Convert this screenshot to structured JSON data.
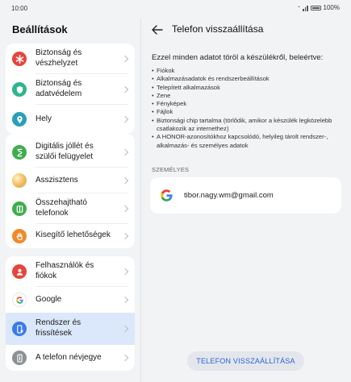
{
  "status_bar": {
    "time": "10:00",
    "battery": "100%"
  },
  "left": {
    "title": "Beállítások",
    "items": [
      {
        "label": "Biztonság és vészhelyzet",
        "icon": "asterisk-icon",
        "color": "#e5453c"
      },
      {
        "label": "Biztonság és adatvédelem",
        "icon": "shield-icon",
        "color": "#2db58e"
      },
      {
        "label": "Hely",
        "icon": "location-icon",
        "color": "#29a0b8"
      },
      {
        "label": "Digitális jóllét és szülői felügyelet",
        "icon": "hourglass-icon",
        "color": "#3fad4f"
      },
      {
        "label": "Asszisztens",
        "icon": "assistant-icon",
        "color": "#f2b24a"
      },
      {
        "label": "Összehajtható telefonok",
        "icon": "foldable-icon",
        "color": "#3fad4f"
      },
      {
        "label": "Kisegítő lehetőségek",
        "icon": "hand-icon",
        "color": "#f08a2a"
      },
      {
        "label": "Felhasználók és fiókok",
        "icon": "user-icon",
        "color": "#e5453c"
      },
      {
        "label": "Google",
        "icon": "google-icon",
        "color": "#ffffff"
      },
      {
        "label": "Rendszer és frissítések",
        "icon": "phone-update-icon",
        "color": "#3b7bea"
      },
      {
        "label": "A telefon névjegye",
        "icon": "phone-info-icon",
        "color": "#8d9196"
      }
    ]
  },
  "right": {
    "title": "Telefon visszaállítása",
    "intro": "Ezzel minden adatot töröl a készülékről, beleértve:",
    "bullets": [
      "Fiókok",
      "Alkalmazásadatok és rendszerbeállítások",
      "Telepített alkalmazások",
      "Zene",
      "Fényképek",
      "Fájlok",
      "Biztonsági chip tartalma (törlődik, amikor a készülék legközelebb csatlakozik az internethez)",
      "A HONOR-azonosítókhoz kapcsolódó, helyileg tárolt rendszer-, alkalmazás- és személyes adatok"
    ],
    "section_label": "SZEMÉLYES",
    "account_email": "tibor.nagy.wm@gmail.com",
    "reset_button": "TELEFON VISSZAÁLLÍTÁSA"
  },
  "colors": {
    "accent": "#2a64d6",
    "selected_bg": "#dbe8fb"
  }
}
